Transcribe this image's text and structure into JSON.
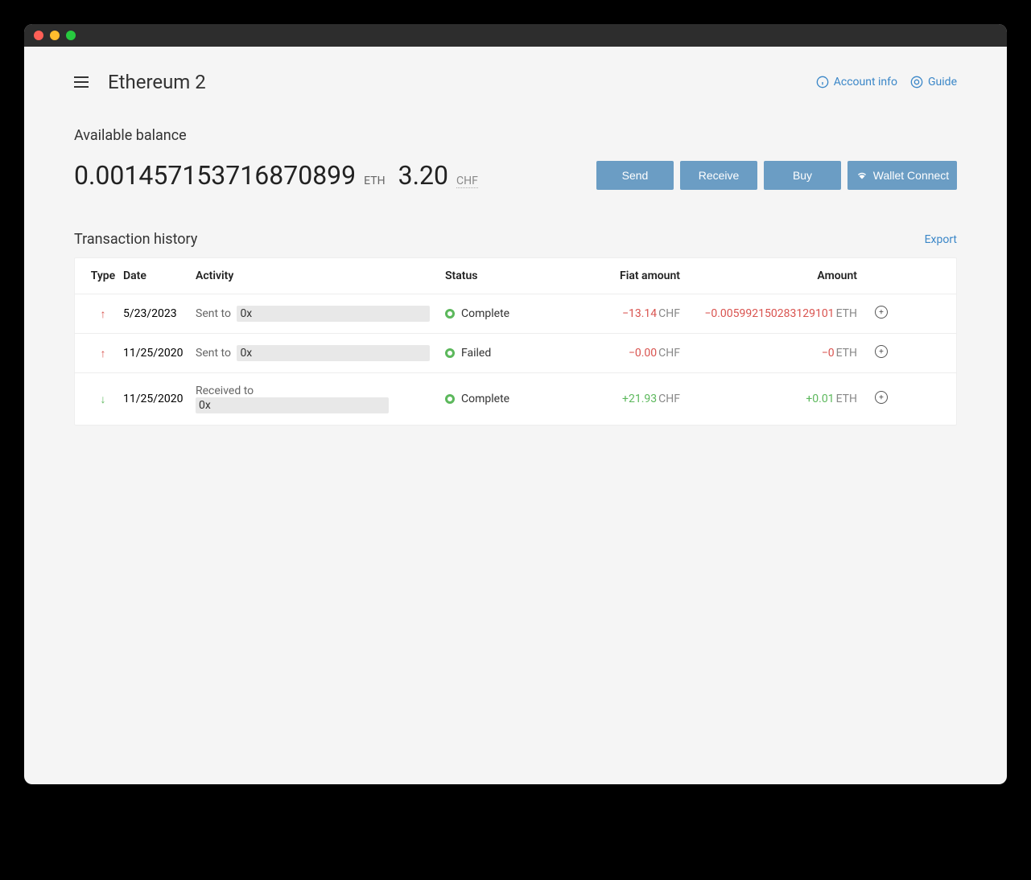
{
  "header": {
    "title": "Ethereum 2",
    "account_info": "Account info",
    "guide": "Guide"
  },
  "balance": {
    "label": "Available balance",
    "amount": "0.001457153716870899",
    "ticker": "ETH",
    "fiat": "3.20",
    "fiat_ticker": "CHF"
  },
  "actions": {
    "send": "Send",
    "receive": "Receive",
    "buy": "Buy",
    "wallet_connect": "Wallet Connect"
  },
  "history": {
    "title": "Transaction history",
    "export": "Export",
    "columns": {
      "type": "Type",
      "date": "Date",
      "activity": "Activity",
      "status": "Status",
      "fiat": "Fiat amount",
      "amount": "Amount"
    },
    "rows": [
      {
        "direction": "out",
        "date": "5/23/2023",
        "activity_label": "Sent to",
        "addr_prefix": "0x",
        "status": "Complete",
        "fiat": "−13.14",
        "fiat_unit": "CHF",
        "amount": "−0.005992150283129101",
        "amount_unit": "ETH",
        "sign": "neg"
      },
      {
        "direction": "out",
        "date": "11/25/2020",
        "activity_label": "Sent to",
        "addr_prefix": "0x",
        "status": "Failed",
        "fiat": "−0.00",
        "fiat_unit": "CHF",
        "amount": "−0",
        "amount_unit": "ETH",
        "sign": "neg"
      },
      {
        "direction": "in",
        "date": "11/25/2020",
        "activity_label": "Received to",
        "addr_prefix": "0x",
        "status": "Complete",
        "fiat": "+21.93",
        "fiat_unit": "CHF",
        "amount": "+0.01",
        "amount_unit": "ETH",
        "sign": "pos"
      }
    ]
  }
}
